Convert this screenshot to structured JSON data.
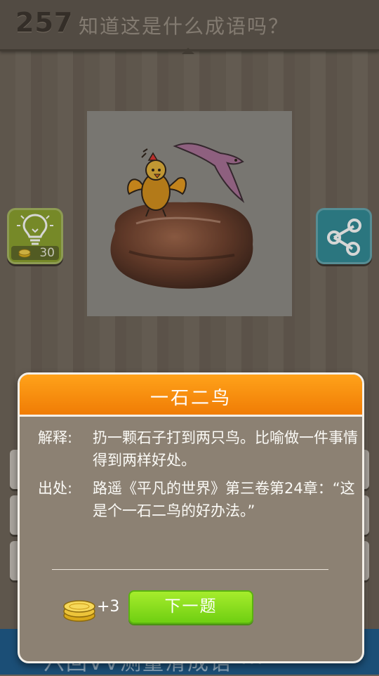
{
  "header": {
    "level_number": "257",
    "question": "知道这是什么成语吗？"
  },
  "hint_button": {
    "cost": "30"
  },
  "banner": {
    "text": "六回VV测量滑成语 ···"
  },
  "modal": {
    "title": "一石二鸟",
    "explanation_label": "解释:",
    "explanation": "扔一颗石子打到两只鸟。比喻做一件事情得到两样好处。",
    "source_label": "出处:",
    "source": "路遥《平凡的世界》第三卷第24章：“这是个一石二鸟的好办法。”",
    "reward": "+3",
    "next_label": "下一题"
  },
  "colors": {
    "title_bar": "#f07c05",
    "next_button": "#6fcf12",
    "hint_button": "#8aa12c",
    "share_button": "#2f8a96"
  },
  "icons": [
    "lightbulb-icon",
    "coins-icon",
    "share-icon"
  ]
}
